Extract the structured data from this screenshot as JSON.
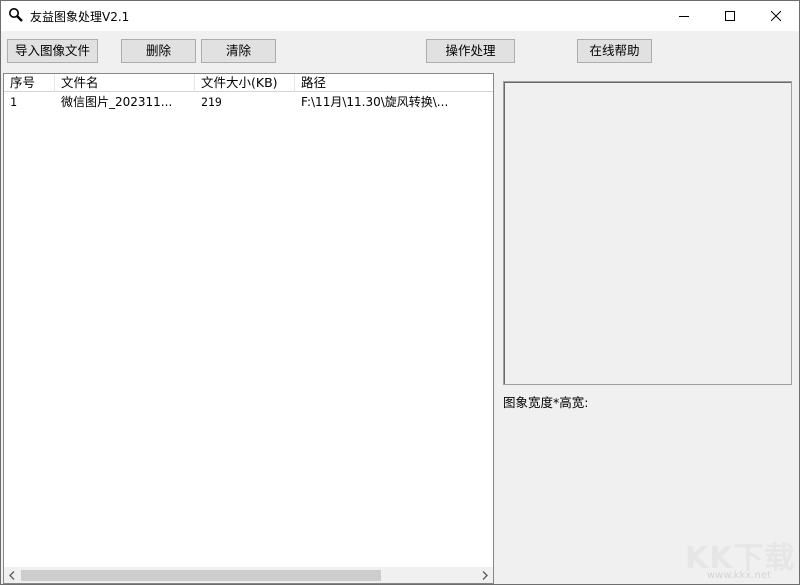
{
  "window": {
    "title": "友益图象处理V2.1"
  },
  "titlebar": {
    "app_icon": "magnifier-icon",
    "minimize_icon": "minimize-icon",
    "maximize_icon": "maximize-icon",
    "close_icon": "close-icon"
  },
  "toolbar": {
    "import_label": "导入图像文件",
    "delete_label": "删除",
    "clear_label": "清除",
    "process_label": "操作处理",
    "help_label": "在线帮助"
  },
  "file_list": {
    "columns": [
      "序号",
      "文件名",
      "文件大小(KB)",
      "路径"
    ],
    "rows": [
      {
        "index": "1",
        "name": "微信图片_202311...",
        "size": "219",
        "path": "F:\\11月\\11.30\\旋风转换\\..."
      }
    ]
  },
  "preview": {
    "dimensions_label": "图象宽度*高宽:"
  },
  "watermark": {
    "text": "KK下载",
    "url": "www.kkx.net"
  },
  "colors": {
    "accent": "#0078d7",
    "window_bg": "#f0f0f0",
    "button_bg": "#e1e1e1"
  }
}
